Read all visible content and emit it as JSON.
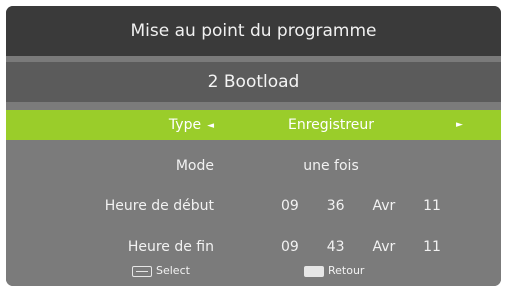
{
  "header": {
    "title": "Mise au point du programme"
  },
  "program": {
    "name": "2 Bootload"
  },
  "rows": {
    "type": {
      "label": "Type",
      "value": "Enregistreur",
      "left_arrow": "◄",
      "right_arrow": "►",
      "selected": true
    },
    "mode": {
      "label": "Mode",
      "value": "une fois"
    },
    "start": {
      "label": "Heure de début",
      "hour": "09",
      "minute": "36",
      "month": "Avr",
      "day": "11"
    },
    "end": {
      "label": "Heure de fin",
      "hour": "09",
      "minute": "43",
      "month": "Avr",
      "day": "11"
    }
  },
  "footer": {
    "select_label": "Select",
    "back_label": "Retour"
  },
  "colors": {
    "highlight": "#9acd2a",
    "title_bar": "#3a3a3a",
    "subtitle_bar": "#5b5b5b",
    "panel": "#7b7b7b"
  },
  "icons": {
    "select_key": "ok-key-icon",
    "back_key": "exit-key-icon"
  }
}
